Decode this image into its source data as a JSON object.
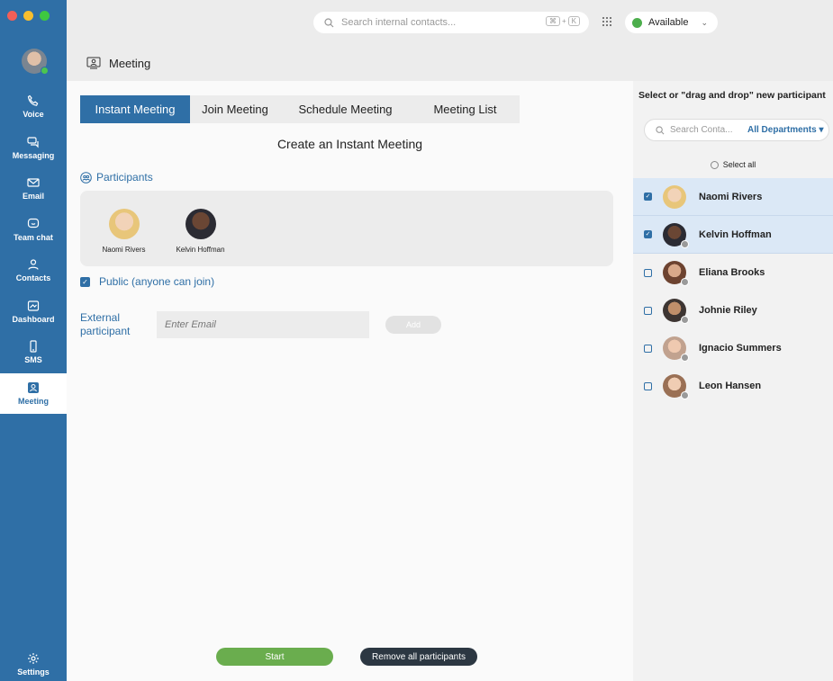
{
  "sidebar": {
    "nav": [
      {
        "label": "Voice",
        "icon": "phone-icon"
      },
      {
        "label": "Messaging",
        "icon": "chat-bubbles-icon"
      },
      {
        "label": "Email",
        "icon": "envelope-icon"
      },
      {
        "label": "Team chat",
        "icon": "team-chat-icon"
      },
      {
        "label": "Contacts",
        "icon": "contacts-icon"
      },
      {
        "label": "Dashboard",
        "icon": "dashboard-icon"
      },
      {
        "label": "SMS",
        "icon": "mobile-icon"
      },
      {
        "label": "Meeting",
        "icon": "meeting-icon"
      }
    ],
    "settings_label": "Settings",
    "accent": "#2f6fa6"
  },
  "topbar": {
    "search_placeholder": "Search internal contacts...",
    "shortcut_key1": "⌘",
    "shortcut_plus": "+",
    "shortcut_key2": "K",
    "status_label": "Available",
    "status_color": "#4cae4c"
  },
  "header": {
    "title": "Meeting"
  },
  "main": {
    "tabs": [
      {
        "label": "Instant Meeting",
        "active": true
      },
      {
        "label": "Join Meeting",
        "active": false
      },
      {
        "label": "Schedule Meeting",
        "active": false
      },
      {
        "label": "Meeting List",
        "active": false
      }
    ],
    "title": "Create an Instant Meeting",
    "participants_label": "Participants",
    "participants": [
      {
        "name": "Naomi Rivers"
      },
      {
        "name": "Kelvin Hoffman"
      }
    ],
    "public_label": "Public (anyone can join)",
    "public_checked": true,
    "external_label": "External participant",
    "email_placeholder": "Enter Email",
    "add_label": "Add",
    "start_label": "Start",
    "remove_label": "Remove all participants"
  },
  "right": {
    "title": "Select or \"drag and drop\" new participant",
    "search_placeholder": "Search Conta...",
    "department": "All Departments",
    "dept_arrow": "▾",
    "select_all": "Select all",
    "contacts": [
      {
        "name": "Naomi Rivers",
        "checked": true
      },
      {
        "name": "Kelvin Hoffman",
        "checked": true
      },
      {
        "name": "Eliana Brooks",
        "checked": false
      },
      {
        "name": "Johnie Riley",
        "checked": false
      },
      {
        "name": "Ignacio Summers",
        "checked": false
      },
      {
        "name": "Leon Hansen",
        "checked": false
      }
    ]
  }
}
